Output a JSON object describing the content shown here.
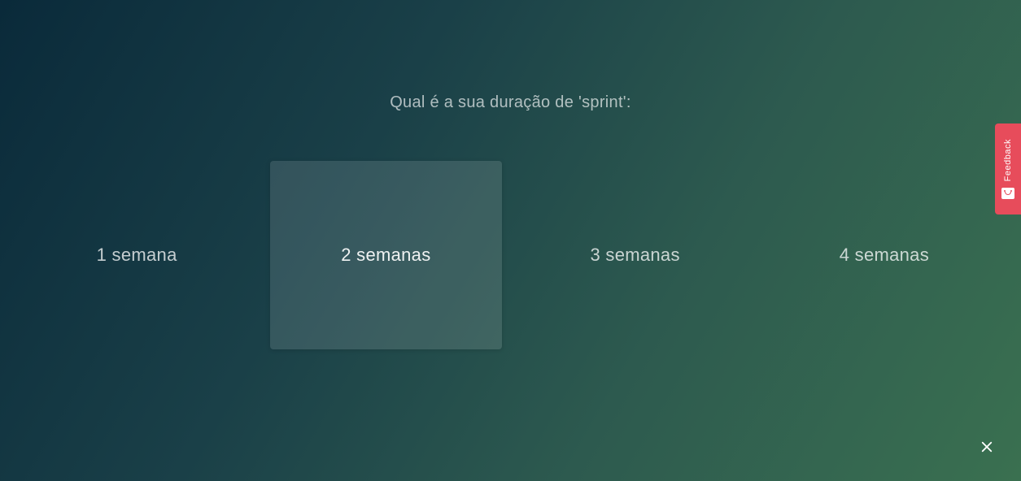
{
  "question": "Qual é a sua duração de 'sprint':",
  "options": [
    {
      "label": "1 semana",
      "selected": false
    },
    {
      "label": "2 semanas",
      "selected": true
    },
    {
      "label": "3 semanas",
      "selected": false
    },
    {
      "label": "4 semanas",
      "selected": false
    }
  ],
  "feedback": {
    "label": "Feedback"
  }
}
